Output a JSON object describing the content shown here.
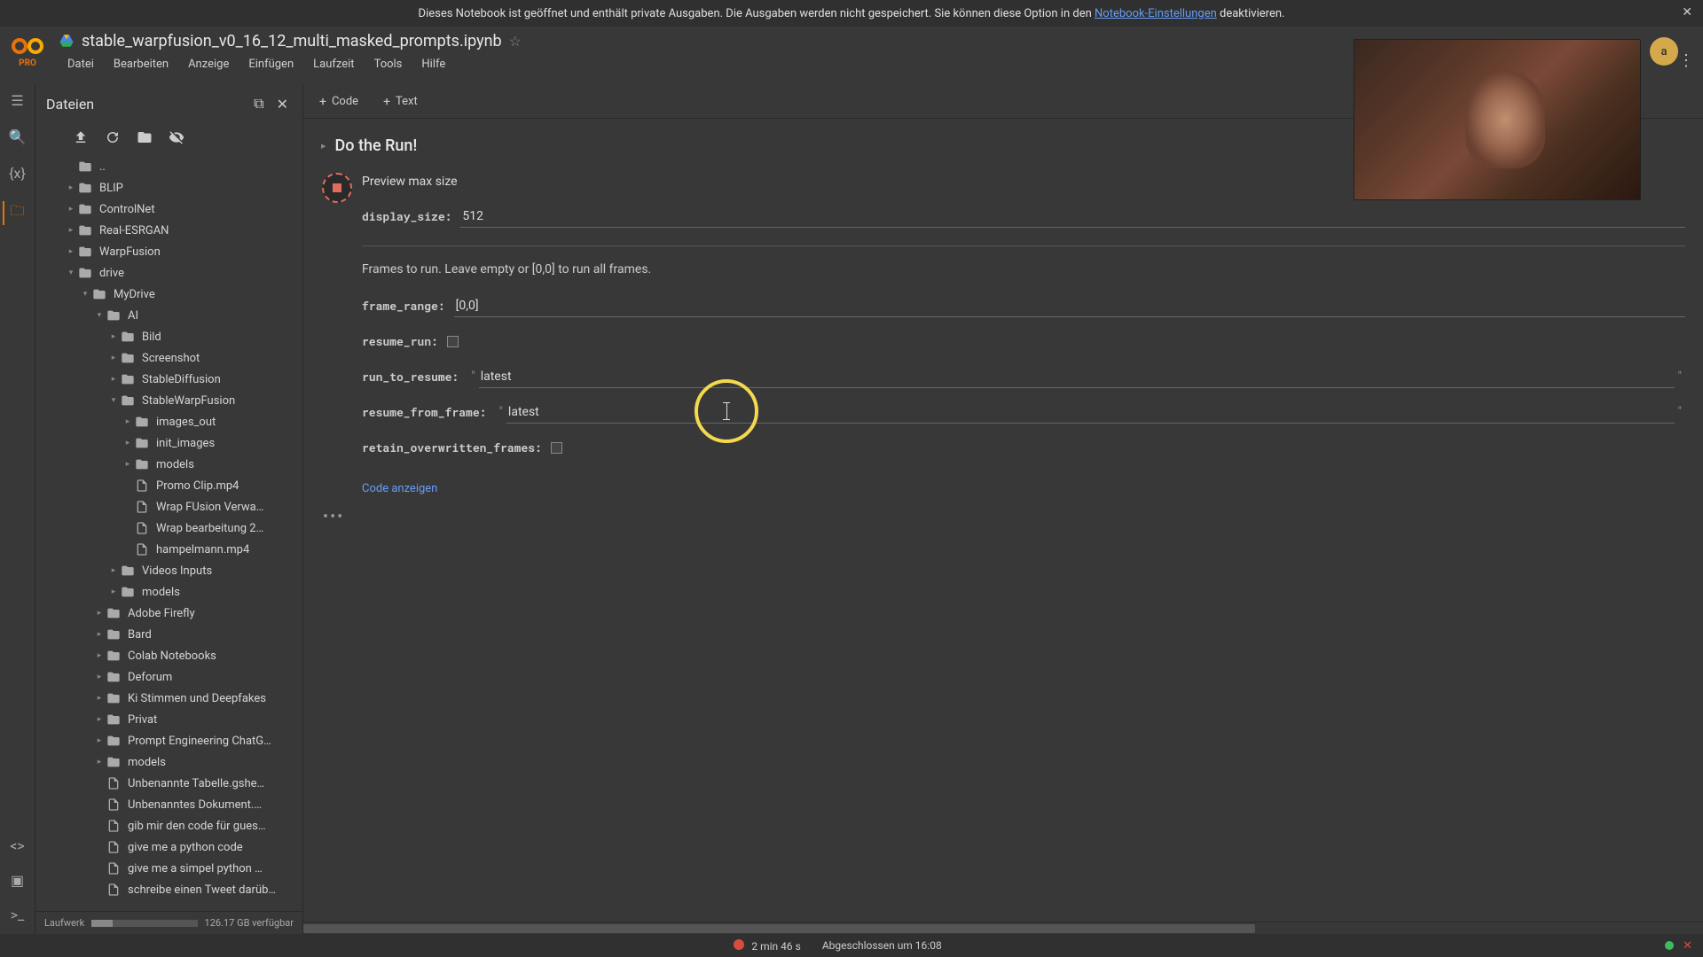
{
  "banner": {
    "text_before": "Dieses Notebook ist geöffnet und enthält private Ausgaben. Die Ausgaben werden nicht gespeichert. Sie können diese Option in den ",
    "link": "Notebook-Einstellungen",
    "text_after": " deaktivieren."
  },
  "header": {
    "pro": "PRO",
    "title": "stable_warpfusion_v0_16_12_multi_masked_prompts.ipynb",
    "menu": [
      "Datei",
      "Bearbeiten",
      "Anzeige",
      "Einfügen",
      "Laufzeit",
      "Tools",
      "Hilfe"
    ],
    "avatar_letter": "a"
  },
  "toolbar": {
    "code": "Code",
    "text": "Text"
  },
  "sidebar": {
    "title": "Dateien",
    "disk_label": "Laufwerk",
    "disk_free": "126.17 GB verfügbar",
    "tree": [
      {
        "d": 0,
        "type": "up",
        "label": ".."
      },
      {
        "d": 0,
        "type": "folder",
        "exp": "▸",
        "label": "BLIP"
      },
      {
        "d": 0,
        "type": "folder",
        "exp": "▸",
        "label": "ControlNet"
      },
      {
        "d": 0,
        "type": "folder",
        "exp": "▸",
        "label": "Real-ESRGAN"
      },
      {
        "d": 0,
        "type": "folder",
        "exp": "▸",
        "label": "WarpFusion"
      },
      {
        "d": 0,
        "type": "folder",
        "exp": "▾",
        "label": "drive"
      },
      {
        "d": 1,
        "type": "folder",
        "exp": "▾",
        "label": "MyDrive"
      },
      {
        "d": 2,
        "type": "folder",
        "exp": "▾",
        "label": "AI"
      },
      {
        "d": 3,
        "type": "folder",
        "exp": "▸",
        "label": "Bild"
      },
      {
        "d": 3,
        "type": "folder",
        "exp": "▸",
        "label": "Screenshot"
      },
      {
        "d": 3,
        "type": "folder",
        "exp": "▸",
        "label": "StableDiffusion"
      },
      {
        "d": 3,
        "type": "folder",
        "exp": "▾",
        "label": "StableWarpFusion"
      },
      {
        "d": 4,
        "type": "folder",
        "exp": "▸",
        "label": "images_out"
      },
      {
        "d": 4,
        "type": "folder",
        "exp": "▸",
        "label": "init_images"
      },
      {
        "d": 4,
        "type": "folder",
        "exp": "▸",
        "label": "models"
      },
      {
        "d": 4,
        "type": "file",
        "label": "Promo Clip.mp4"
      },
      {
        "d": 4,
        "type": "file",
        "label": "Wrap FUsion Verwa…"
      },
      {
        "d": 4,
        "type": "file",
        "label": "Wrap bearbeitung 2…"
      },
      {
        "d": 4,
        "type": "file",
        "label": "hampelmann.mp4"
      },
      {
        "d": 3,
        "type": "folder",
        "exp": "▸",
        "label": "Videos Inputs"
      },
      {
        "d": 3,
        "type": "folder",
        "exp": "▸",
        "label": "models"
      },
      {
        "d": 2,
        "type": "folder",
        "exp": "▸",
        "label": "Adobe Firefly"
      },
      {
        "d": 2,
        "type": "folder",
        "exp": "▸",
        "label": "Bard"
      },
      {
        "d": 2,
        "type": "folder",
        "exp": "▸",
        "label": "Colab Notebooks"
      },
      {
        "d": 2,
        "type": "folder",
        "exp": "▸",
        "label": "Deforum"
      },
      {
        "d": 2,
        "type": "folder",
        "exp": "▸",
        "label": "Ki Stimmen und Deepfakes"
      },
      {
        "d": 2,
        "type": "folder",
        "exp": "▸",
        "label": "Privat"
      },
      {
        "d": 2,
        "type": "folder",
        "exp": "▸",
        "label": "Prompt Engineering ChatG…"
      },
      {
        "d": 2,
        "type": "folder",
        "exp": "▸",
        "label": "models"
      },
      {
        "d": 2,
        "type": "file",
        "label": "Unbenannte Tabelle.gshe…"
      },
      {
        "d": 2,
        "type": "file",
        "label": "Unbenanntes Dokument.…"
      },
      {
        "d": 2,
        "type": "file",
        "label": "gib mir den code für gues…"
      },
      {
        "d": 2,
        "type": "file",
        "label": "give me a python code"
      },
      {
        "d": 2,
        "type": "file",
        "label": "give me a simpel python …"
      },
      {
        "d": 2,
        "type": "file",
        "label": "schreibe einen Tweet darüb…"
      }
    ]
  },
  "notebook": {
    "section_title": "Do the Run!",
    "cell": {
      "preview_title": "Preview max size",
      "display_size_label": "display_size:",
      "display_size_value": "512",
      "frames_help": "Frames to run. Leave empty or [0,0] to run all frames.",
      "frame_range_label": "frame_range:",
      "frame_range_value": "[0,0]",
      "resume_run_label": "resume_run:",
      "run_to_resume_label": "run_to_resume:",
      "run_to_resume_value": "latest",
      "resume_from_frame_label": "resume_from_frame:",
      "resume_from_frame_value": "latest",
      "retain_label": "retain_overwritten_frames:",
      "show_code": "Code anzeigen"
    }
  },
  "status": {
    "time": "2 min 46 s",
    "completed": "Abgeschlossen um 16:08"
  }
}
